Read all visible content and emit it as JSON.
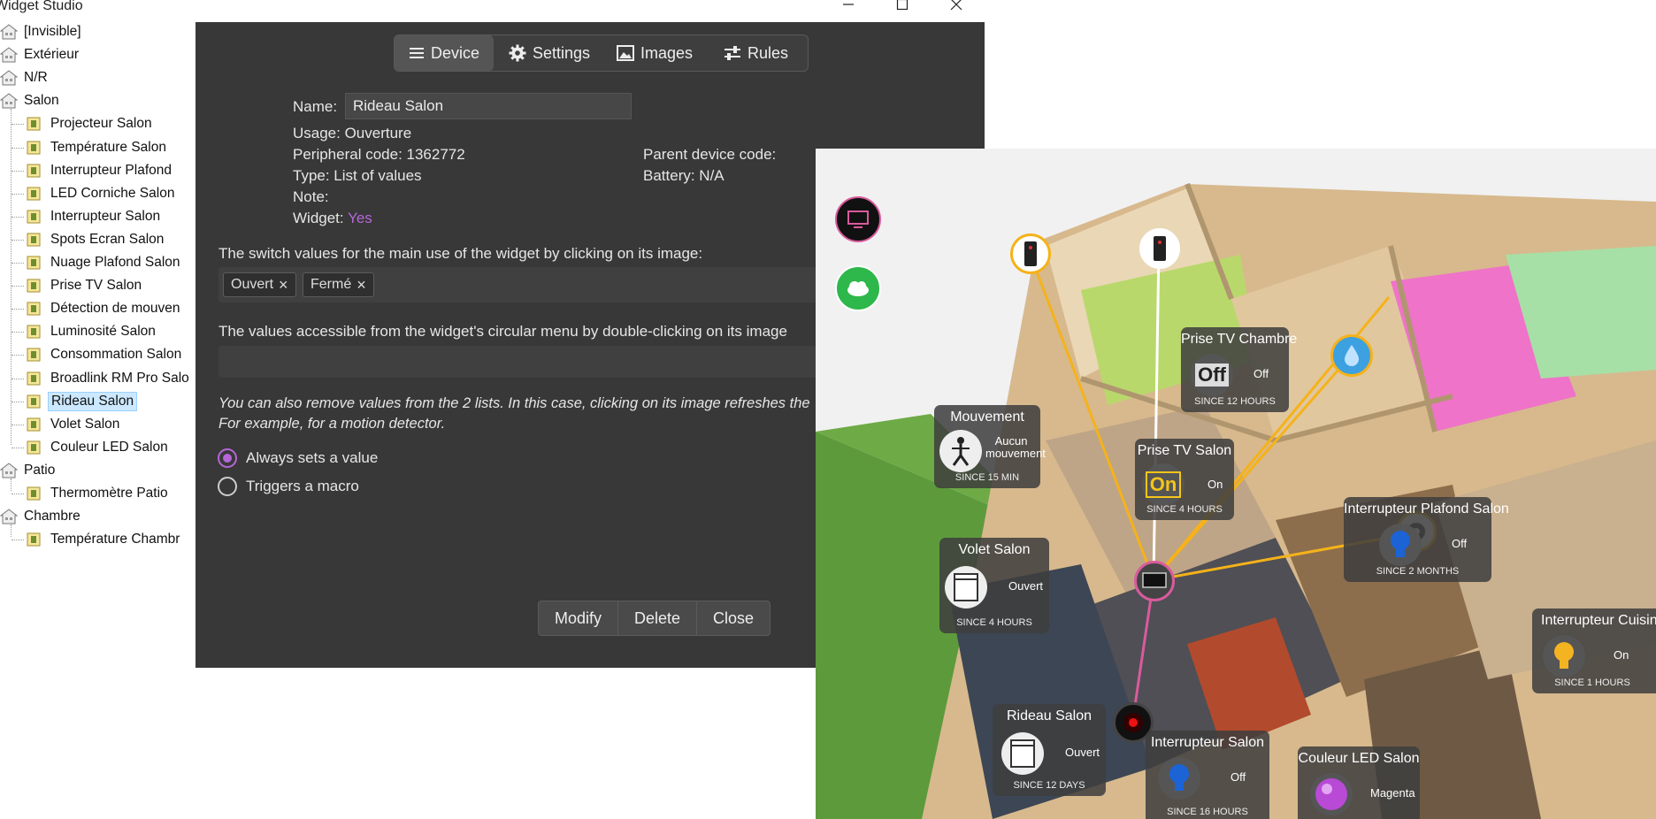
{
  "window": {
    "title": "Widget Studio"
  },
  "tree": {
    "rooms": [
      {
        "label": "[Invisible]"
      },
      {
        "label": "Extérieur"
      },
      {
        "label": "N/R"
      },
      {
        "label": "Salon",
        "devices": [
          "Projecteur Salon",
          "Température Salon",
          "Interrupteur Plafond",
          "LED Corniche Salon",
          "Interrupteur Salon",
          "Spots Ecran Salon",
          "Nuage Plafond Salon",
          "Prise TV Salon",
          "Détection de mouven",
          "Luminosité Salon",
          "Consommation Salon",
          "Broadlink RM Pro Salo",
          "Rideau Salon",
          "Volet Salon",
          "Couleur LED Salon"
        ]
      },
      {
        "label": "Patio",
        "devices": [
          "Thermomètre Patio"
        ]
      },
      {
        "label": "Chambre",
        "devices": [
          "Température Chambr"
        ]
      }
    ],
    "selected": "Rideau Salon"
  },
  "dialog": {
    "tabs": [
      {
        "label": "Device",
        "icon": "menu-icon"
      },
      {
        "label": "Settings",
        "icon": "gear-icon"
      },
      {
        "label": "Images",
        "icon": "image-icon"
      },
      {
        "label": "Rules",
        "icon": "sliders-icon"
      }
    ],
    "active_tab": "Device",
    "name_label": "Name:",
    "name_value": "Rideau Salon",
    "usage": "Usage: Ouverture",
    "peripheral_code": "Peripheral code: 1362772",
    "type": "Type: List of values",
    "note": "Note:",
    "widget_label": "Widget:",
    "widget_value": "Yes",
    "parent_device_code": "Parent device code:",
    "battery": "Battery: N/A",
    "switch_values_label": "The switch values for the main use of the widget by clicking on its image:",
    "switch_values": [
      "Ouvert",
      "Fermé"
    ],
    "circular_menu_label": "The values accessible from the widget's circular menu by double-clicking on its image",
    "remove_hint_1": "You can also remove values from the 2 lists. In this case, clicking on its image refreshes the",
    "remove_hint_2": "For example, for a motion detector.",
    "radio_options": [
      "Always sets a value",
      "Triggers a macro"
    ],
    "radio_selected": "Always sets a value",
    "buttons": [
      "Modify",
      "Delete",
      "Close"
    ],
    "accent_color": "#b566d8"
  },
  "floorplan": {
    "widgets": [
      {
        "title": "Prise TV Chambre",
        "state": "Off",
        "since": "SINCE 12 HOURS",
        "icon": "off-switch-icon"
      },
      {
        "title": "Mouvement",
        "state": "Aucun mouvement",
        "since": "SINCE 15 MIN",
        "icon": "person-icon"
      },
      {
        "title": "Prise TV Salon",
        "state": "On",
        "since": "SINCE 4 HOURS",
        "icon": "on-switch-icon"
      },
      {
        "title": "Interrupteur Plafond Salon",
        "state": "Off",
        "since": "SINCE 2 MONTHS",
        "icon": "bulb-icon"
      },
      {
        "title": "Volet Salon",
        "state": "Ouvert",
        "since": "SINCE 4 HOURS",
        "icon": "shutter-icon"
      },
      {
        "title": "Interrupteur Cuisin",
        "state": "On",
        "since": "SINCE 1 HOURS",
        "icon": "bulb-icon"
      },
      {
        "title": "Rideau Salon",
        "state": "Ouvert",
        "since": "SINCE 12 DAYS",
        "icon": "shutter-icon"
      },
      {
        "title": "Interrupteur Salon",
        "state": "Off",
        "since": "SINCE 16 HOURS",
        "icon": "bulb-icon"
      },
      {
        "title": "Couleur LED Salon",
        "state": "Magenta",
        "since": "",
        "icon": "color-bulb-icon"
      }
    ],
    "colors": {
      "link": "#f5b21a",
      "link_white": "#ffffff",
      "link_pink": "#d95b9c",
      "bulb_blue": "#1c63d6",
      "bulb_yellow": "#f4b321",
      "led_purple": "#b84ad6"
    }
  }
}
